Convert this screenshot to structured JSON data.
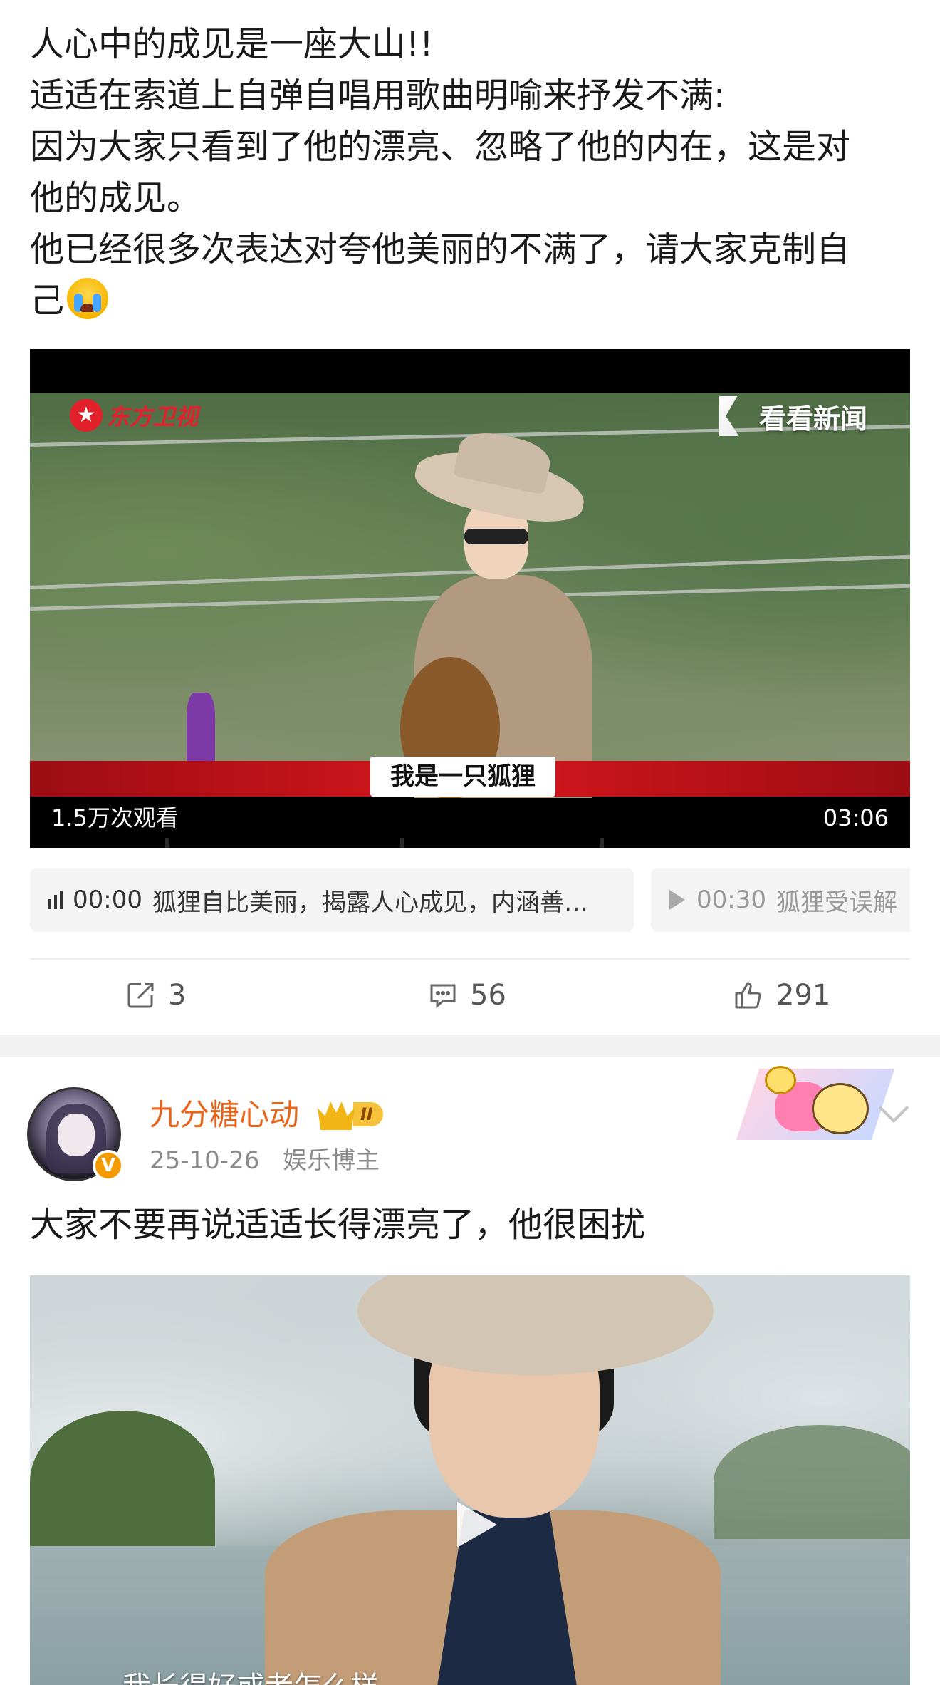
{
  "post1": {
    "text_lines": [
      "人心中的成见是一座大山!!",
      "适适在索道上自弹自唱用歌曲明喻来抒发不满:",
      "因为大家只看到了他的漂亮、忽略了他的内在，这是对",
      "他的成见。",
      "他已经很多次表达对夸他美丽的不满了，请大家克制自",
      "己"
    ],
    "emoji": "crying-face-emoji",
    "video": {
      "channel_logo_left": "东方卫视",
      "channel_logo_right": "看看新闻",
      "subtitle": "我是一只狐狸",
      "views": "1.5万次观看",
      "duration": "03:06"
    },
    "chapters": [
      {
        "time": "00:00",
        "title": "狐狸自比美丽，揭露人心成见，内涵善…",
        "icon": "audio-bars-icon",
        "active": true
      },
      {
        "time": "00:30",
        "title": "狐狸受误解",
        "icon": "play-outline-icon",
        "active": false
      }
    ],
    "actions": {
      "repost_count": "3",
      "comment_count": "56",
      "like_count": "291"
    }
  },
  "post2": {
    "author": "九分糖心动",
    "level_badge": "II",
    "verified": "V",
    "date": "25-10-26",
    "tag": "娱乐博主",
    "text": "大家不要再说适适长得漂亮了，他很困扰",
    "video_subtitle": "我长得好或者怎么样"
  },
  "colors": {
    "author_name": "#e8641a",
    "meta_gray": "#8a8a8a",
    "banner_red": "#d7161e",
    "badge_gold": "#f6c23a"
  }
}
